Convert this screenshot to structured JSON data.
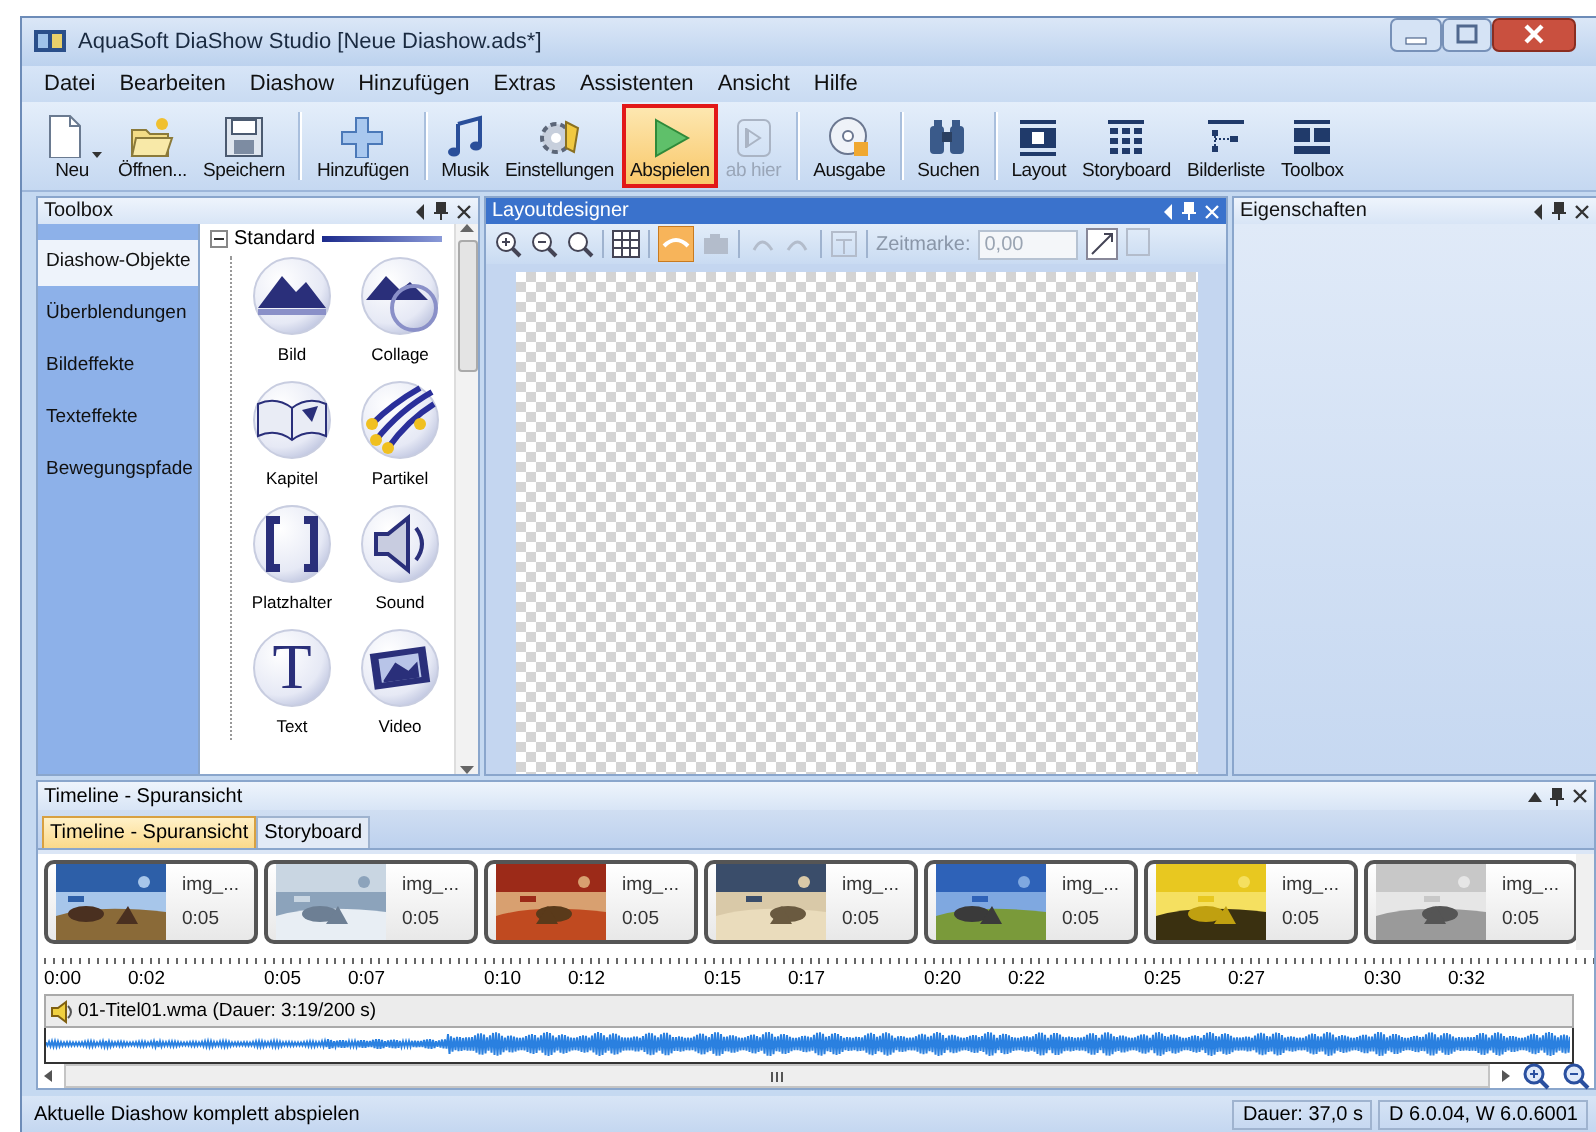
{
  "window": {
    "title": "AquaSoft DiaShow Studio [Neue Diashow.ads*]"
  },
  "menu": [
    "Datei",
    "Bearbeiten",
    "Diashow",
    "Hinzufügen",
    "Extras",
    "Assistenten",
    "Ansicht",
    "Hilfe"
  ],
  "toolbar": [
    [
      {
        "label": "Neu",
        "selected": false,
        "disabled": false
      },
      {
        "label": "Öffnen...",
        "selected": false,
        "disabled": false
      },
      {
        "label": "Speichern",
        "selected": false,
        "disabled": false
      }
    ],
    [
      {
        "label": "Hinzufügen",
        "selected": false,
        "disabled": false
      }
    ],
    [
      {
        "label": "Musik",
        "selected": false,
        "disabled": false
      },
      {
        "label": "Einstellungen",
        "selected": false,
        "disabled": false
      },
      {
        "label": "Abspielen",
        "selected": true,
        "disabled": false
      },
      {
        "label": "ab hier",
        "selected": false,
        "disabled": true
      }
    ],
    [
      {
        "label": "Ausgabe",
        "selected": false,
        "disabled": false
      }
    ],
    [
      {
        "label": "Suchen",
        "selected": false,
        "disabled": false
      }
    ],
    [
      {
        "label": "Layout",
        "selected": false,
        "disabled": false
      },
      {
        "label": "Storyboard",
        "selected": false,
        "disabled": false
      },
      {
        "label": "Bilderliste",
        "selected": false,
        "disabled": false
      },
      {
        "label": "Toolbox",
        "selected": false,
        "disabled": false
      }
    ]
  ],
  "toolbox": {
    "title": "Toolbox",
    "categories": [
      {
        "label": "Diashow-Objekte",
        "selected": true
      },
      {
        "label": "Überblendungen",
        "selected": false
      },
      {
        "label": "Bildeffekte",
        "selected": false
      },
      {
        "label": "Texteffekte",
        "selected": false
      },
      {
        "label": "Bewegungspfade",
        "selected": false
      }
    ],
    "group": {
      "label": "Standard",
      "expanded": true
    },
    "items": [
      {
        "label": "Bild"
      },
      {
        "label": "Collage"
      },
      {
        "label": "Kapitel"
      },
      {
        "label": "Partikel"
      },
      {
        "label": "Platzhalter"
      },
      {
        "label": "Sound"
      },
      {
        "label": "Text",
        "glyph": "T"
      },
      {
        "label": "Video"
      }
    ]
  },
  "layout_designer": {
    "title": "Layoutdesigner",
    "time_label": "Zeitmarke:",
    "time_field": {
      "value": "0,00",
      "disabled": true
    }
  },
  "properties": {
    "title": "Eigenschaften"
  },
  "timeline": {
    "title": "Timeline - Spuransicht",
    "tabs": [
      {
        "label": "Timeline - Spuransicht",
        "selected": true
      },
      {
        "label": "Storyboard",
        "selected": false
      }
    ],
    "clips": [
      {
        "name": "img_...",
        "duration": "0:05"
      },
      {
        "name": "img_...",
        "duration": "0:05"
      },
      {
        "name": "img_...",
        "duration": "0:05"
      },
      {
        "name": "img_...",
        "duration": "0:05"
      },
      {
        "name": "img_...",
        "duration": "0:05"
      },
      {
        "name": "img_...",
        "duration": "0:05"
      },
      {
        "name": "img_...",
        "duration": "0:05"
      }
    ],
    "ruler": [
      {
        "major": "0:00",
        "minor": "0:02"
      },
      {
        "major": "0:05",
        "minor": "0:07"
      },
      {
        "major": "0:10",
        "minor": "0:12"
      },
      {
        "major": "0:15",
        "minor": "0:17"
      },
      {
        "major": "0:20",
        "minor": "0:22"
      },
      {
        "major": "0:25",
        "minor": "0:27"
      },
      {
        "major": "0:30",
        "minor": "0:32"
      }
    ],
    "audio": {
      "label": "01-Titel01.wma (Dauer: 3:19/200 s)"
    }
  },
  "status_bar": {
    "message": "Aktuelle Diashow komplett abspielen",
    "fields": [
      "Dauer: 37,0 s",
      "D 6.0.04, W 6.0.6001"
    ]
  }
}
